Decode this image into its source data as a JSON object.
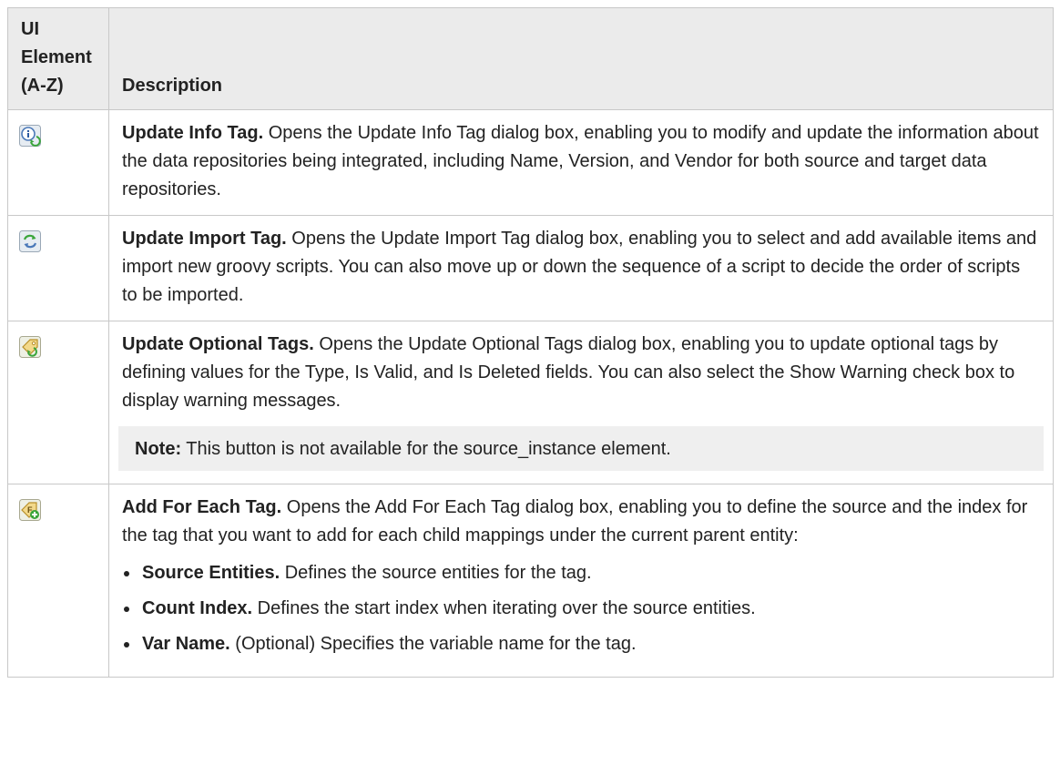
{
  "header": {
    "col1_line1": "UI",
    "col1_line2": "Element",
    "col1_line3": "(A-Z)",
    "col2": "Description"
  },
  "rows": [
    {
      "icon": "update-info-tag-icon",
      "title": "Update Info Tag.",
      "text": " Opens the Update Info Tag dialog box, enabling you to modify and update the information about the data repositories being integrated, including Name, Version, and Vendor for both source and target data repositories."
    },
    {
      "icon": "update-import-tag-icon",
      "title": "Update Import Tag.",
      "text": " Opens the Update Import Tag dialog box, enabling you to select and add available items and import new groovy scripts. You can also move up or down the sequence of a script to decide the order of scripts to be imported."
    },
    {
      "icon": "update-optional-tags-icon",
      "title": "Update Optional Tags.",
      "text": " Opens the Update Optional Tags dialog box, enabling you to update optional tags by defining values for the Type, Is Valid, and Is Deleted fields. You can also select the Show Warning check box to display warning messages.",
      "note_label": "Note:",
      "note_text": " This button is not available for the source_instance element."
    },
    {
      "icon": "add-for-each-tag-icon",
      "title": "Add For Each Tag.",
      "text": " Opens the Add For Each Tag dialog box, enabling you to define the source and the index for the tag that you want to add for each child mappings under the current parent entity:",
      "bullets": [
        {
          "label": "Source Entities.",
          "text": " Defines the source entities for the tag."
        },
        {
          "label": "Count Index.",
          "text": " Defines the start index when iterating over the source entities."
        },
        {
          "label": "Var Name.",
          "text": " (Optional) Specifies the variable name for the tag."
        }
      ]
    }
  ]
}
